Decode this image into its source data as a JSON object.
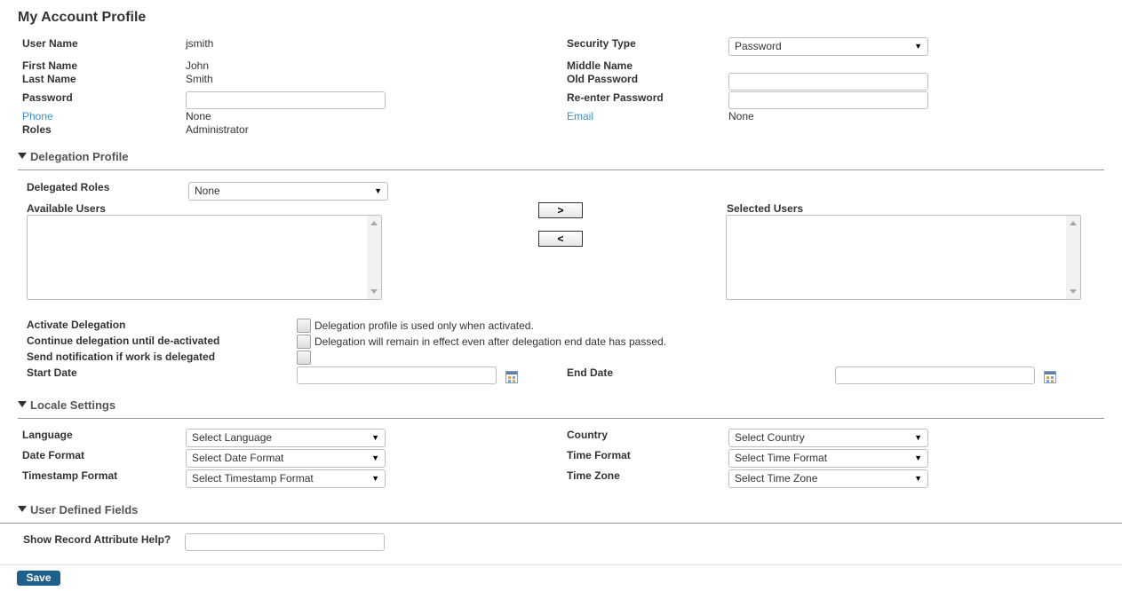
{
  "page": {
    "title": "My Account Profile"
  },
  "account": {
    "username_label": "User Name",
    "username_value": "jsmith",
    "firstname_label": "First Name",
    "firstname_value": "John",
    "lastname_label": "Last Name",
    "lastname_value": "Smith",
    "password_label": "Password",
    "phone_label": "Phone",
    "phone_value": "None",
    "roles_label": "Roles",
    "roles_value": "Administrator",
    "security_type_label": "Security Type",
    "security_type_value": "Password",
    "middlename_label": "Middle Name",
    "old_password_label": "Old Password",
    "reenter_password_label": "Re-enter Password",
    "email_label": "Email",
    "email_value": "None"
  },
  "delegation": {
    "section_title": "Delegation Profile",
    "delegated_roles_label": "Delegated Roles",
    "delegated_roles_value": "None",
    "available_users_label": "Available Users",
    "selected_users_label": "Selected Users",
    "add_button": ">",
    "remove_button": "<",
    "activate_label": "Activate Delegation",
    "activate_desc": "Delegation profile is used only when activated.",
    "continue_label": "Continue delegation until de-activated",
    "continue_desc": "Delegation will remain in effect even after delegation end date has passed.",
    "notify_label": "Send notification if work is delegated",
    "start_date_label": "Start Date",
    "end_date_label": "End Date"
  },
  "locale": {
    "section_title": "Locale Settings",
    "language_label": "Language",
    "language_value": "Select Language",
    "date_format_label": "Date Format",
    "date_format_value": "Select Date Format",
    "timestamp_label": "Timestamp Format",
    "timestamp_value": "Select Timestamp Format",
    "country_label": "Country",
    "country_value": "Select Country",
    "time_format_label": "Time Format",
    "time_format_value": "Select Time Format",
    "timezone_label": "Time Zone",
    "timezone_value": "Select Time Zone"
  },
  "udf": {
    "section_title": "User Defined Fields",
    "record_help_label": "Show Record Attribute Help?"
  },
  "footer": {
    "save_label": "Save"
  },
  "icons": {
    "dropdown": "chevron-down-icon",
    "calendar": "calendar-icon",
    "collapse": "collapse-triangle-icon"
  },
  "colors": {
    "link": "#3b8fc0",
    "save_button": "#1f5f8b"
  }
}
